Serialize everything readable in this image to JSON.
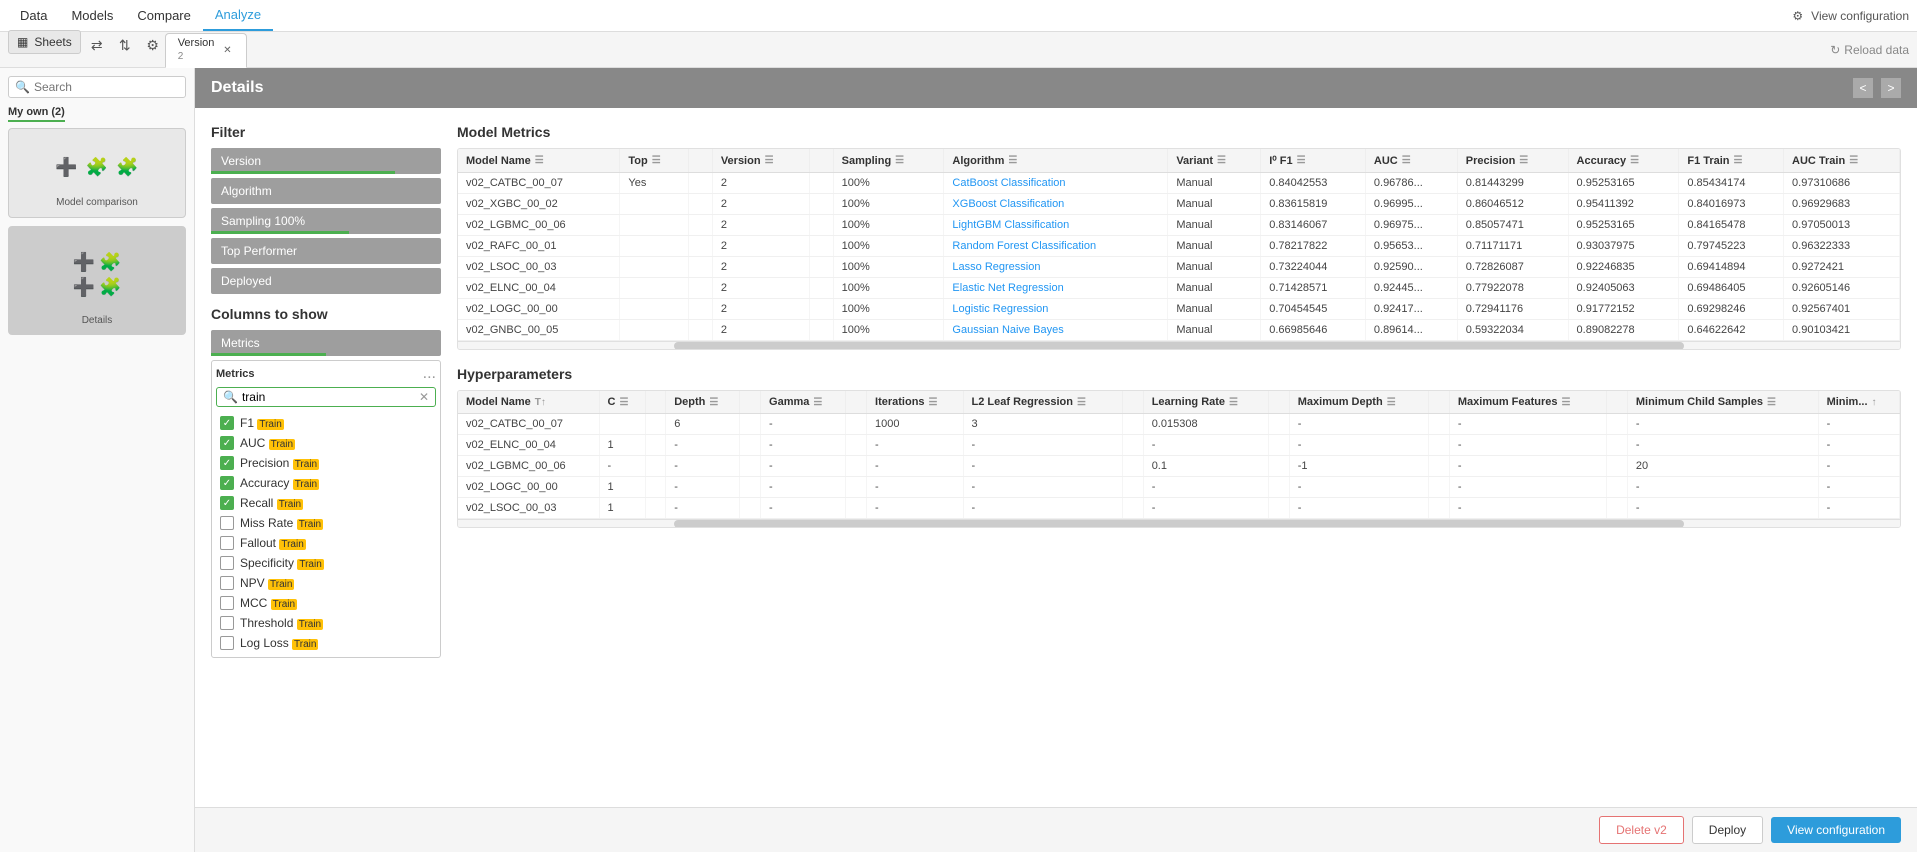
{
  "nav": {
    "items": [
      "Data",
      "Models",
      "Compare",
      "Analyze"
    ],
    "active": "Analyze",
    "view_config_label": "View configuration"
  },
  "tabs": {
    "active_tab": {
      "label": "Version",
      "version": "2"
    },
    "reload_label": "Reload data"
  },
  "details": {
    "title": "Details",
    "nav_prev": "<",
    "nav_next": ">"
  },
  "sidebar": {
    "sheets_label": "Sheets",
    "search_placeholder": "Search",
    "my_own_label": "My own (2)",
    "card1_label": "Model comparison",
    "card2_label": "Details"
  },
  "filter": {
    "title": "Filter",
    "items": [
      "Version",
      "Algorithm",
      "Sampling 100%",
      "Top Performer",
      "Deployed"
    ]
  },
  "columns": {
    "title": "Columns to show",
    "metrics_label": "Metrics",
    "search_value": "train",
    "dots_label": "...",
    "items": [
      {
        "label": "F1",
        "highlight": "Train",
        "checked": true
      },
      {
        "label": "AUC",
        "highlight": "Train",
        "checked": true
      },
      {
        "label": "Precision",
        "highlight": "Train",
        "checked": true
      },
      {
        "label": "Accuracy",
        "highlight": "Train",
        "checked": true
      },
      {
        "label": "Recall",
        "highlight": "Train",
        "checked": true
      },
      {
        "label": "Miss Rate",
        "highlight": "Train",
        "checked": false
      },
      {
        "label": "Fallout",
        "highlight": "Train",
        "checked": false
      },
      {
        "label": "Specificity",
        "highlight": "Train",
        "checked": false
      },
      {
        "label": "NPV",
        "highlight": "Train",
        "checked": false
      },
      {
        "label": "MCC",
        "highlight": "Train",
        "checked": false
      },
      {
        "label": "Threshold",
        "highlight": "Train",
        "checked": false
      },
      {
        "label": "Log Loss",
        "highlight": "Train",
        "checked": false
      }
    ]
  },
  "model_metrics": {
    "title": "Model Metrics",
    "columns": [
      "Model Name",
      "Top",
      "Version",
      "Sampling",
      "Algorithm",
      "Variant",
      "I⁰ F1",
      "AUC",
      "Precision",
      "Accuracy",
      "F1 Train",
      "AUC Train"
    ],
    "rows": [
      {
        "name": "v02_CATBC_00_07",
        "top": "Yes",
        "version": "2",
        "sampling": "100%",
        "algorithm": "CatBoost Classification",
        "variant": "Manual",
        "if1": "0.84042553",
        "auc": "0.96786...",
        "precision": "0.81443299",
        "accuracy": "0.95253165",
        "f1_train": "0.85434174",
        "auc_train": "0.97310686"
      },
      {
        "name": "v02_XGBC_00_02",
        "top": "",
        "version": "2",
        "sampling": "100%",
        "algorithm": "XGBoost Classification",
        "variant": "Manual",
        "if1": "0.83615819",
        "auc": "0.96995...",
        "precision": "0.86046512",
        "accuracy": "0.95411392",
        "f1_train": "0.84016973",
        "auc_train": "0.96929683"
      },
      {
        "name": "v02_LGBMC_00_06",
        "top": "",
        "version": "2",
        "sampling": "100%",
        "algorithm": "LightGBM Classification",
        "variant": "Manual",
        "if1": "0.83146067",
        "auc": "0.96975...",
        "precision": "0.85057471",
        "accuracy": "0.95253165",
        "f1_train": "0.84165478",
        "auc_train": "0.97050013"
      },
      {
        "name": "v02_RAFC_00_01",
        "top": "",
        "version": "2",
        "sampling": "100%",
        "algorithm": "Random Forest Classification",
        "variant": "Manual",
        "if1": "0.78217822",
        "auc": "0.95653...",
        "precision": "0.71171171",
        "accuracy": "0.93037975",
        "f1_train": "0.79745223",
        "auc_train": "0.96322333"
      },
      {
        "name": "v02_LSOC_00_03",
        "top": "",
        "version": "2",
        "sampling": "100%",
        "algorithm": "Lasso Regression",
        "variant": "Manual",
        "if1": "0.73224044",
        "auc": "0.92590...",
        "precision": "0.72826087",
        "accuracy": "0.92246835",
        "f1_train": "0.69414894",
        "auc_train": "0.9272421"
      },
      {
        "name": "v02_ELNC_00_04",
        "top": "",
        "version": "2",
        "sampling": "100%",
        "algorithm": "Elastic Net Regression",
        "variant": "Manual",
        "if1": "0.71428571",
        "auc": "0.92445...",
        "precision": "0.77922078",
        "accuracy": "0.92405063",
        "f1_train": "0.69486405",
        "auc_train": "0.92605146"
      },
      {
        "name": "v02_LOGC_00_00",
        "top": "",
        "version": "2",
        "sampling": "100%",
        "algorithm": "Logistic Regression",
        "variant": "Manual",
        "if1": "0.70454545",
        "auc": "0.92417...",
        "precision": "0.72941176",
        "accuracy": "0.91772152",
        "f1_train": "0.69298246",
        "auc_train": "0.92567401"
      },
      {
        "name": "v02_GNBC_00_05",
        "top": "",
        "version": "2",
        "sampling": "100%",
        "algorithm": "Gaussian Naive Bayes",
        "variant": "Manual",
        "if1": "0.66985646",
        "auc": "0.89614...",
        "precision": "0.59322034",
        "accuracy": "0.89082278",
        "f1_train": "0.64622642",
        "auc_train": "0.90103421"
      }
    ]
  },
  "hyperparameters": {
    "title": "Hyperparameters",
    "columns": [
      "Model Name",
      "T↑",
      "C",
      "Depth",
      "Gamma",
      "Iterations",
      "L2 Leaf Regression",
      "Learning Rate",
      "Maximum Depth",
      "Maximum Features",
      "Minimum Child Samples",
      "Minim"
    ],
    "rows": [
      {
        "name": "v02_CATBC_00_07",
        "t": "",
        "c": "",
        "depth": "6",
        "gamma": "",
        "iterations": "1000",
        "l2": "3",
        "lr": "0.015308",
        "max_depth": "",
        "max_features": "",
        "min_child": "",
        "minim": ""
      },
      {
        "name": "v02_ELNC_00_04",
        "t": "",
        "c": "1",
        "depth": "",
        "gamma": "",
        "iterations": "",
        "l2": "",
        "lr": "",
        "max_depth": "",
        "max_features": "",
        "min_child": "",
        "minim": ""
      },
      {
        "name": "v02_LGBMC_00_06",
        "t": "",
        "c": "",
        "depth": "",
        "gamma": "",
        "iterations": "",
        "l2": "",
        "lr": "0.1",
        "max_depth": "-1",
        "max_features": "",
        "min_child": "20",
        "minim": ""
      },
      {
        "name": "v02_LOGC_00_00",
        "t": "",
        "c": "1",
        "depth": "",
        "gamma": "",
        "iterations": "",
        "l2": "",
        "lr": "",
        "max_depth": "",
        "max_features": "",
        "min_child": "",
        "minim": ""
      },
      {
        "name": "v02_LSOC_00_03",
        "t": "",
        "c": "1",
        "depth": "",
        "gamma": "",
        "iterations": "",
        "l2": "",
        "lr": "",
        "max_depth": "",
        "max_features": "",
        "min_child": "",
        "minim": ""
      }
    ]
  },
  "bottom_bar": {
    "delete_label": "Delete v2",
    "deploy_label": "Deploy",
    "view_config_label": "View configuration"
  }
}
